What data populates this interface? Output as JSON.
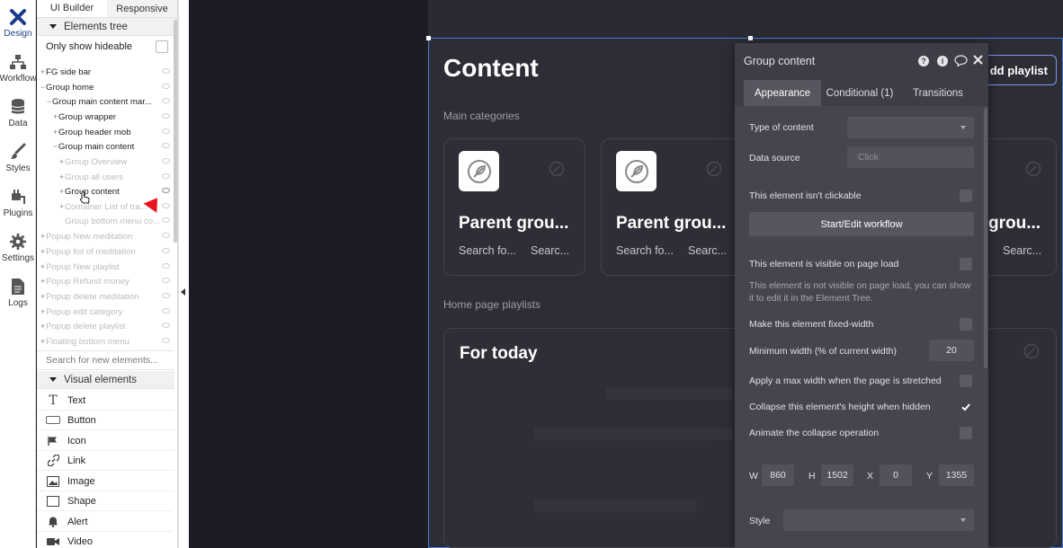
{
  "colors": {
    "accent": "#1a3a8a",
    "canvas": "#1d1c24",
    "page": "#2d2d36",
    "panel": "#45454f",
    "selection": "#4a7bd8",
    "pointer": "#e8131f"
  },
  "rail": [
    {
      "label": "Design",
      "icon": "design-x-icon"
    },
    {
      "label": "Workflow",
      "icon": "workflow-icon"
    },
    {
      "label": "Data",
      "icon": "database-icon"
    },
    {
      "label": "Styles",
      "icon": "brush-icon"
    },
    {
      "label": "Plugins",
      "icon": "plug-icon"
    },
    {
      "label": "Settings",
      "icon": "gear-icon"
    },
    {
      "label": "Logs",
      "icon": "document-icon"
    }
  ],
  "tree_tabs": {
    "builder": "UI Builder",
    "responsive": "Responsive"
  },
  "elements_tree": {
    "heading": "Elements tree",
    "only_hideable": "Only show hideable",
    "rows": [
      {
        "label": "FG side bar",
        "prefix": "+"
      },
      {
        "label": "Group home",
        "prefix": "−"
      },
      {
        "label": "Group main content mar...",
        "prefix": "−"
      },
      {
        "label": "Group wrapper",
        "prefix": "+"
      },
      {
        "label": "Group header mob",
        "prefix": "+"
      },
      {
        "label": "Group main content",
        "prefix": "−"
      },
      {
        "label": "Group Overview",
        "prefix": "+"
      },
      {
        "label": "Group all users",
        "prefix": "+"
      },
      {
        "label": "Group content",
        "prefix": "+"
      },
      {
        "label": "Container List of tra...",
        "prefix": "+"
      },
      {
        "label": "Group bottom menu co...",
        "prefix": ""
      },
      {
        "label": "Popup New meditation",
        "prefix": "+"
      },
      {
        "label": "Popup list of meditation",
        "prefix": "+"
      },
      {
        "label": "Popup New playlist",
        "prefix": "+"
      },
      {
        "label": "Popup Refund money",
        "prefix": "+"
      },
      {
        "label": "Popup delete meditation",
        "prefix": "+"
      },
      {
        "label": "Popup edit category",
        "prefix": "+"
      },
      {
        "label": "Popup delete playlist",
        "prefix": "+"
      },
      {
        "label": "Floating bottom menu",
        "prefix": "+"
      }
    ],
    "search_placeholder": "Search for new elements..."
  },
  "visual_elements": {
    "heading": "Visual elements",
    "items": [
      {
        "label": "Text",
        "icon": "text-t-icon"
      },
      {
        "label": "Button",
        "icon": "button-icon"
      },
      {
        "label": "Icon",
        "icon": "flag-icon"
      },
      {
        "label": "Link",
        "icon": "link-icon"
      },
      {
        "label": "Image",
        "icon": "image-icon"
      },
      {
        "label": "Shape",
        "icon": "shape-icon"
      },
      {
        "label": "Alert",
        "icon": "bell-icon"
      },
      {
        "label": "Video",
        "icon": "video-icon"
      }
    ]
  },
  "canvas": {
    "title": "Content",
    "add_button": "dd playlist",
    "main_categories": "Main categories",
    "cards": [
      {
        "title": "Parent grou...",
        "sub1": "Search fo...",
        "sub2": "Searc..."
      },
      {
        "title": "Parent grou...",
        "sub1": "Search fo...",
        "sub2": "Searc..."
      },
      {
        "title": "grou...",
        "sub1": "",
        "sub2": "Searc..."
      }
    ],
    "playlists_label": "Home page playlists",
    "playlist_title": "For today"
  },
  "property_editor": {
    "title": "Group content",
    "tabs": {
      "appearance": "Appearance",
      "conditional": "Conditional (1)",
      "transitions": "Transitions"
    },
    "type_of_content": "Type of content",
    "data_source": "Data source",
    "data_source_placeholder": "Click",
    "not_clickable": "This element isn't clickable",
    "workflow_button": "Start/Edit workflow",
    "visible_on_load": "This element is visible on page load",
    "hidden_note": "This element is not visible on page load, you can show it to edit it in the Element Tree.",
    "fixed_width": "Make this element fixed-width",
    "min_width": "Minimum width (% of current width)",
    "min_width_value": "20",
    "max_width": "Apply a max width when the page is stretched",
    "collapse_height": "Collapse this element's height when hidden",
    "animate_collapse": "Animate the collapse operation",
    "geometry": {
      "w_label": "W",
      "w": "860",
      "h_label": "H",
      "h": "1502",
      "x_label": "X",
      "x": "0",
      "y_label": "Y",
      "y": "1355"
    },
    "style": "Style"
  }
}
